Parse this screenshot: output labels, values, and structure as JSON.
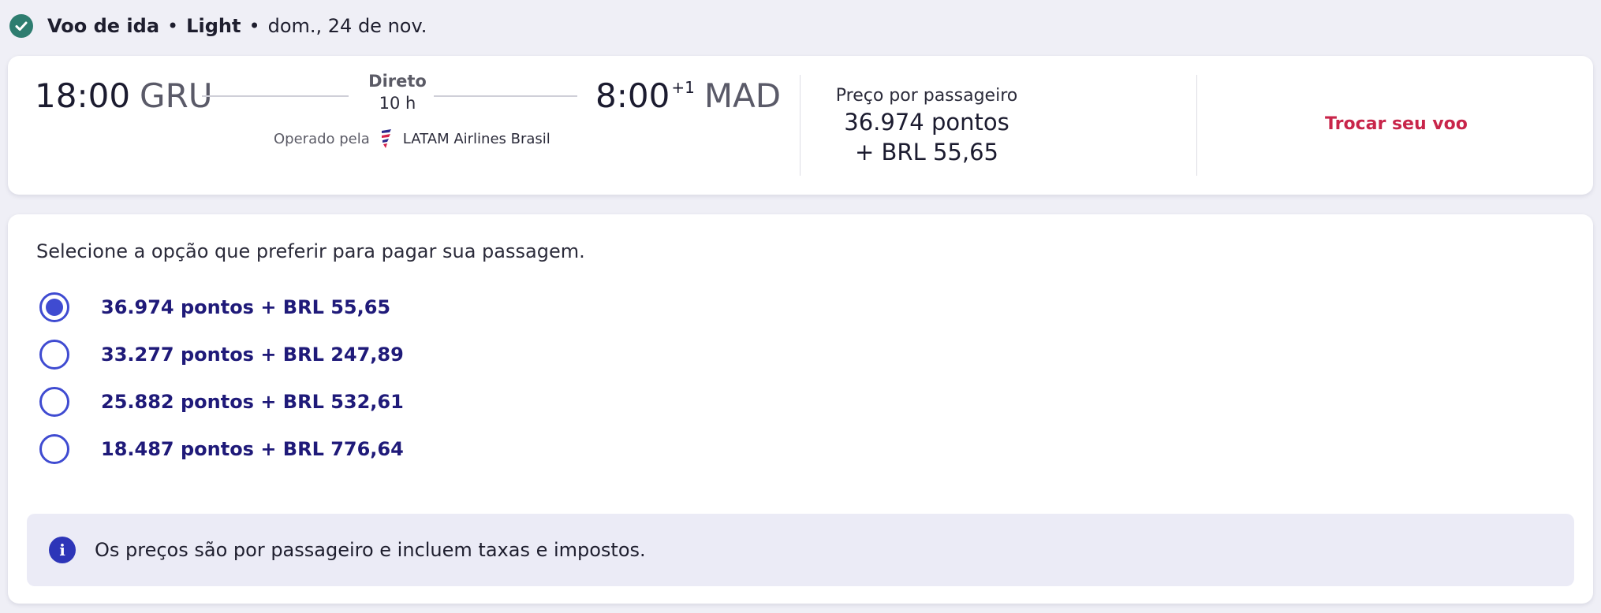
{
  "summary": {
    "leg": "Voo de ida",
    "fare": "Light",
    "date": "dom., 24 de nov.",
    "separator": "•"
  },
  "flight": {
    "departure_time": "18:00",
    "departure_code": "GRU",
    "stops_label": "Direto",
    "duration": "10 h",
    "arrival_time": "8:00",
    "arrival_day_offset": "+1",
    "arrival_code": "MAD",
    "operated_by_label": "Operado pela",
    "airline": "LATAM Airlines Brasil"
  },
  "price": {
    "label": "Preço por passageiro",
    "points": "36.974 pontos",
    "cash": "+ BRL 55,65"
  },
  "change_flight_label": "Trocar seu voo",
  "payment": {
    "title": "Selecione a opção que preferir para pagar sua passagem.",
    "options": [
      {
        "label": "36.974 pontos + BRL 55,65",
        "selected": true
      },
      {
        "label": "33.277 pontos + BRL 247,89",
        "selected": false
      },
      {
        "label": "25.882 pontos + BRL 532,61",
        "selected": false
      },
      {
        "label": "18.487 pontos + BRL 776,64",
        "selected": false
      }
    ],
    "info": "Os preços são por passageiro e incluem taxas e impostos."
  },
  "colors": {
    "accent": "#3f4bd1",
    "option_text": "#1f1a79",
    "change_link": "#c8254a",
    "check": "#2e7d70"
  }
}
